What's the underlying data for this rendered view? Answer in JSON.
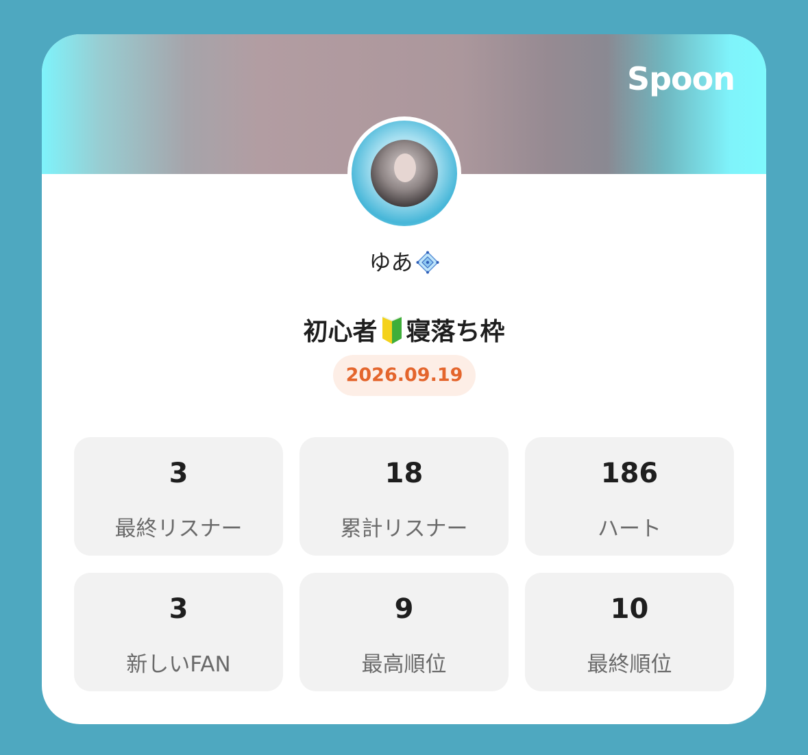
{
  "card": {
    "brand": "Spoon",
    "username": "ゆあ",
    "username_badge_icon": "diamond-gem-icon",
    "title_part1": "初心者",
    "title_icon": "beginner-mark-icon",
    "title_part2": "寝落ち枠",
    "date": "2026.09.19"
  },
  "stats": [
    {
      "value": "3",
      "label": "最終リスナー"
    },
    {
      "value": "18",
      "label": "累計リスナー"
    },
    {
      "value": "186",
      "label": "ハート"
    },
    {
      "value": "3",
      "label": "新しいFAN"
    },
    {
      "value": "9",
      "label": "最高順位"
    },
    {
      "value": "10",
      "label": "最終順位"
    }
  ],
  "colors": {
    "page_background": "#4ea8c0",
    "banner_edge": "#7ef3fb",
    "date_text": "#e4652c",
    "date_background": "#fdeee6",
    "stat_background": "#f2f2f2"
  }
}
